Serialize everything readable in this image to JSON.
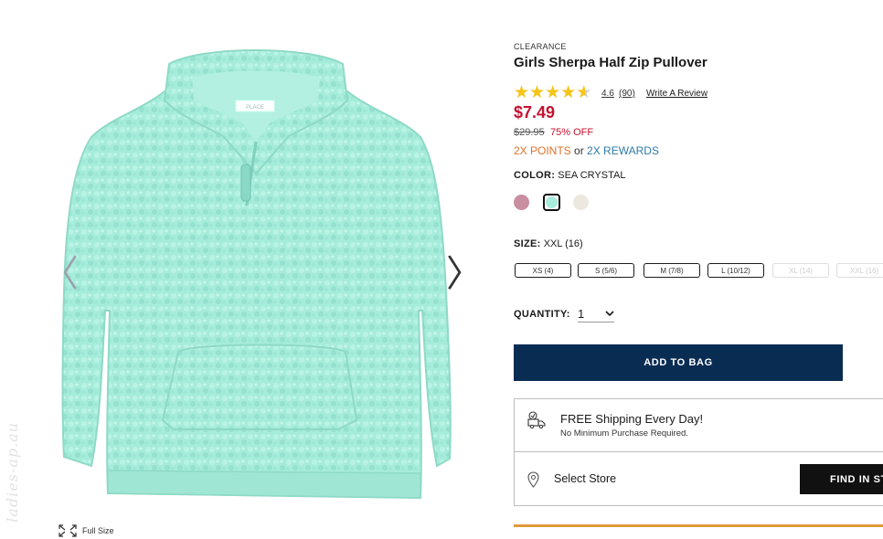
{
  "product": {
    "badge": "CLEARANCE",
    "title": "Girls Sherpa Half Zip Pullover",
    "rating_value": "4.6",
    "rating_count": "(90)",
    "rating_fraction": 0.92,
    "write_review": "Write A Review",
    "price": "$7.49",
    "original_price": "$29.95",
    "discount": "75% OFF",
    "points_text": "2X POINTS",
    "points_or": "or",
    "rewards_text": "2X REWARDS",
    "color_label": "COLOR:",
    "color_value": "SEA CRYSTAL",
    "swatches": [
      {
        "name": "pink",
        "color": "#c98fa0"
      },
      {
        "name": "sea-crystal",
        "color": "#a8ecdc",
        "selected": true
      },
      {
        "name": "cream",
        "color": "#ece8df"
      }
    ],
    "size_label": "SIZE:",
    "size_value": "XXL (16)",
    "sizes": [
      {
        "label": "XS (4)",
        "available": true
      },
      {
        "label": "S (5/6)",
        "available": true
      },
      {
        "label": "M (7/8)",
        "available": true
      },
      {
        "label": "L (10/12)",
        "available": true
      },
      {
        "label": "XL (14)",
        "available": false
      },
      {
        "label": "XXL (16)",
        "available": false
      }
    ],
    "quantity_label": "QUANTITY:",
    "quantity_value": "1",
    "add_to_bag": "ADD TO BAG"
  },
  "shipping": {
    "title": "FREE Shipping Every Day!",
    "subtitle": "No Minimum Purchase Required.",
    "select_store": "Select Store",
    "find_in_store": "FIND IN STORE"
  },
  "gallery": {
    "full_size": "Full Size",
    "prev_arrow": "〈",
    "next_arrow": "〉",
    "tag_text": "PLACE",
    "watermark": "ladies-ap.au",
    "garment_color": "#a6ecdb"
  },
  "colors": {
    "price_red": "#c4122f",
    "points_orange": "#e0722a",
    "rewards_blue": "#2e7aa8",
    "button_navy": "#092c53",
    "star_gold": "#f5c518"
  }
}
